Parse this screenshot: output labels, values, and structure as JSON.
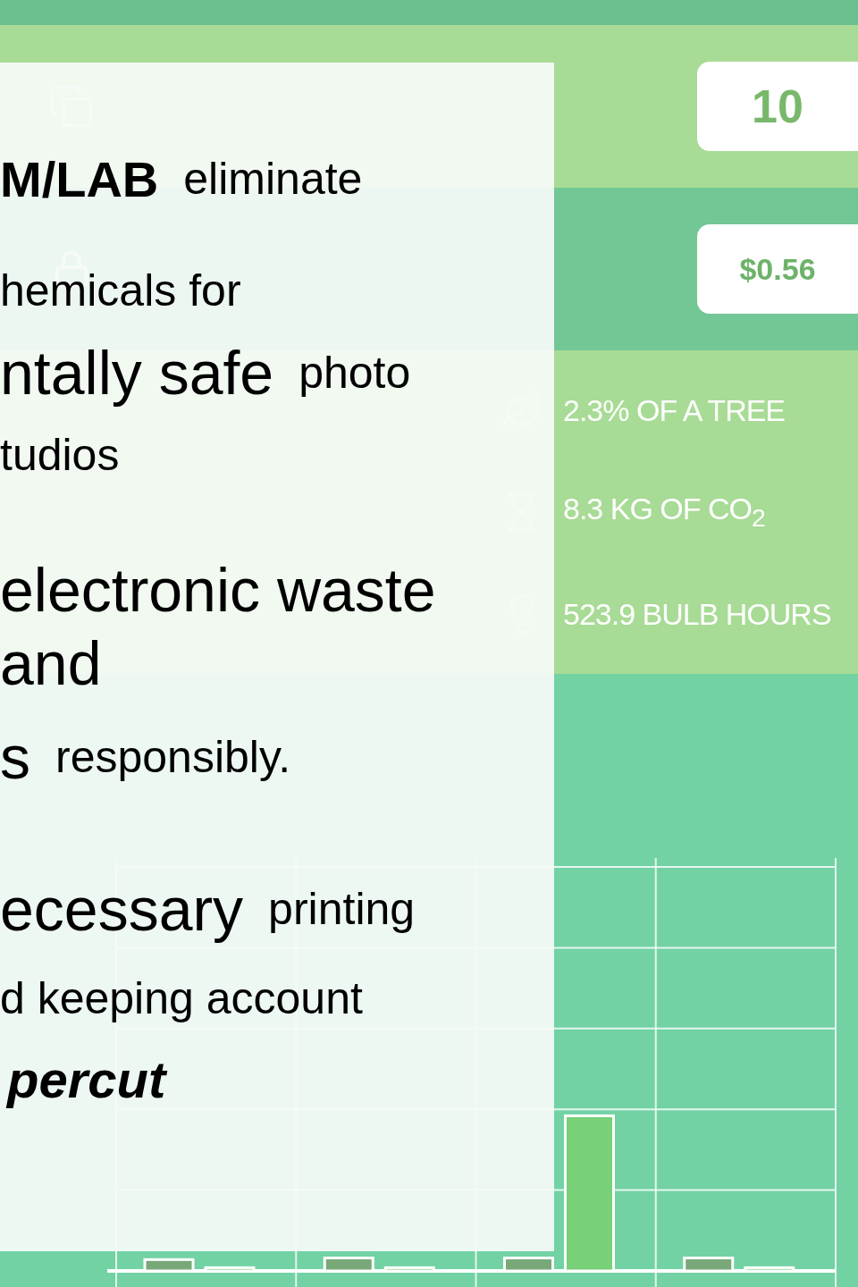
{
  "stats": [
    {
      "value": "10",
      "kind": "sheets"
    },
    {
      "value": "$0.56",
      "kind": "cost"
    }
  ],
  "impact": {
    "items": [
      {
        "text": "2.3% OF A TREE",
        "kind": "leaf"
      },
      {
        "text": "8.3 KG OF CO$_{2}$",
        "kind": "hourglass"
      },
      {
        "text": "523.9 BULB HOURS",
        "kind": "bulb"
      }
    ]
  },
  "promo": {
    "lines": [
      {
        "segments": [
          {
            "text": "M/LAB",
            "kind": "brand"
          },
          {
            "text": "eliminate",
            "kind": "plain"
          }
        ]
      },
      {
        "segments": [
          {
            "text": "hemicals for",
            "kind": "plain"
          }
        ]
      },
      {
        "segments": [
          {
            "text": "ntally safe",
            "kind": "key"
          },
          {
            "text": "photo",
            "kind": "plain"
          }
        ]
      },
      {
        "segments": [
          {
            "text": "tudios",
            "kind": "plain"
          }
        ]
      },
      {
        "segments": [
          {
            "text": "electronic waste",
            "kind": "key"
          }
        ]
      },
      {
        "segments": [
          {
            "text": "and",
            "kind": "key"
          }
        ]
      },
      {
        "segments": [
          {
            "text": "s",
            "kind": "key"
          },
          {
            "text": "responsibly.",
            "kind": "plain"
          }
        ]
      },
      {
        "segments": [
          {
            "text": "ecessary",
            "kind": "key"
          },
          {
            "text": "printing",
            "kind": "plain"
          }
        ]
      },
      {
        "segments": [
          {
            "text": "d keeping account",
            "kind": "plain"
          }
        ]
      },
      {
        "segments": [
          {
            "text": "percut",
            "kind": "accent"
          }
        ]
      }
    ]
  }
}
